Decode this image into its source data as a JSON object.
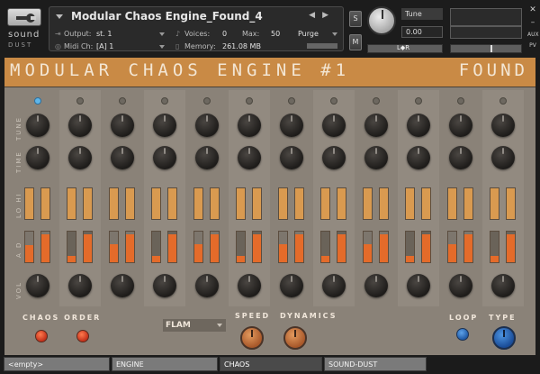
{
  "header": {
    "brand_line1": "sound",
    "brand_line2": "DUST",
    "instrument_title": "Modular Chaos Engine_Found_4",
    "output_label": "Output:",
    "output_value": "st. 1",
    "voices_label": "Voices:",
    "voices_value": "0",
    "max_label": "Max:",
    "max_value": "50",
    "purge_label": "Purge",
    "midi_label": "Midi Ch:",
    "midi_value": "[A]  1",
    "memory_label": "Memory:",
    "memory_value": "261.08 MB",
    "solo_label": "S",
    "mute_label": "M",
    "tune_label": "Tune",
    "tune_value": "0.00",
    "pan_label": "L◆R",
    "side_aux": "AUX",
    "side_pv": "PV"
  },
  "panel": {
    "banner_title": "MODULAR CHAOS ENGINE #1",
    "banner_right": "FOUND",
    "row_labels": [
      "TUNE",
      "TIME",
      "LO HI",
      "A D",
      "VOL"
    ],
    "chaos_order_label": "CHAOS ORDER",
    "flam_value": "FLAM",
    "speed_label": "SPEED",
    "dynamics_label": "DYNAMICS",
    "loop_label": "LOOP",
    "type_label": "TYPE",
    "active_column": 1,
    "attack_levels": [
      0.55,
      0.2,
      0.6,
      0.2,
      0.6,
      0.2,
      0.6,
      0.2,
      0.6,
      0.2,
      0.6,
      0.2
    ],
    "decay_levels": [
      0.9,
      0.9,
      0.9,
      0.9,
      0.9,
      0.9,
      0.9,
      0.9,
      0.9,
      0.9,
      0.9,
      0.9
    ]
  },
  "tabs": [
    {
      "label": "<empty>",
      "active": false
    },
    {
      "label": "ENGINE",
      "active": false
    },
    {
      "label": "CHAOS",
      "active": true
    },
    {
      "label": "SOUND-DUST",
      "active": false
    }
  ],
  "colors": {
    "banner": "#c98a45",
    "panel": "#8a8278",
    "attack_fill": "#e46b2a",
    "led_active": "#5fb6ea"
  }
}
